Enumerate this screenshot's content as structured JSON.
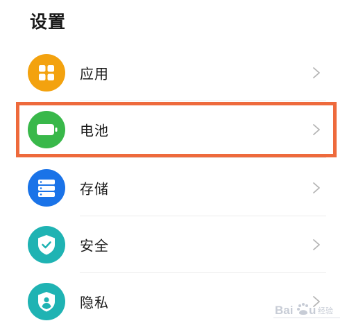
{
  "header": {
    "title": "设置"
  },
  "settings": {
    "items": [
      {
        "label": "应用",
        "icon": "apps-grid-icon",
        "color": "#f3a20f"
      },
      {
        "label": "电池",
        "icon": "battery-icon",
        "color": "#39b84a"
      },
      {
        "label": "存储",
        "icon": "storage-icon",
        "color": "#1a73e8"
      },
      {
        "label": "安全",
        "icon": "shield-check-icon",
        "color": "#1fb3b3"
      },
      {
        "label": "隐私",
        "icon": "privacy-icon",
        "color": "#1fb3b3"
      }
    ]
  },
  "annotation": {
    "color": "#ee6a3c",
    "highlighted_item": "电池"
  },
  "watermark": {
    "text": "Baidu 经验"
  }
}
